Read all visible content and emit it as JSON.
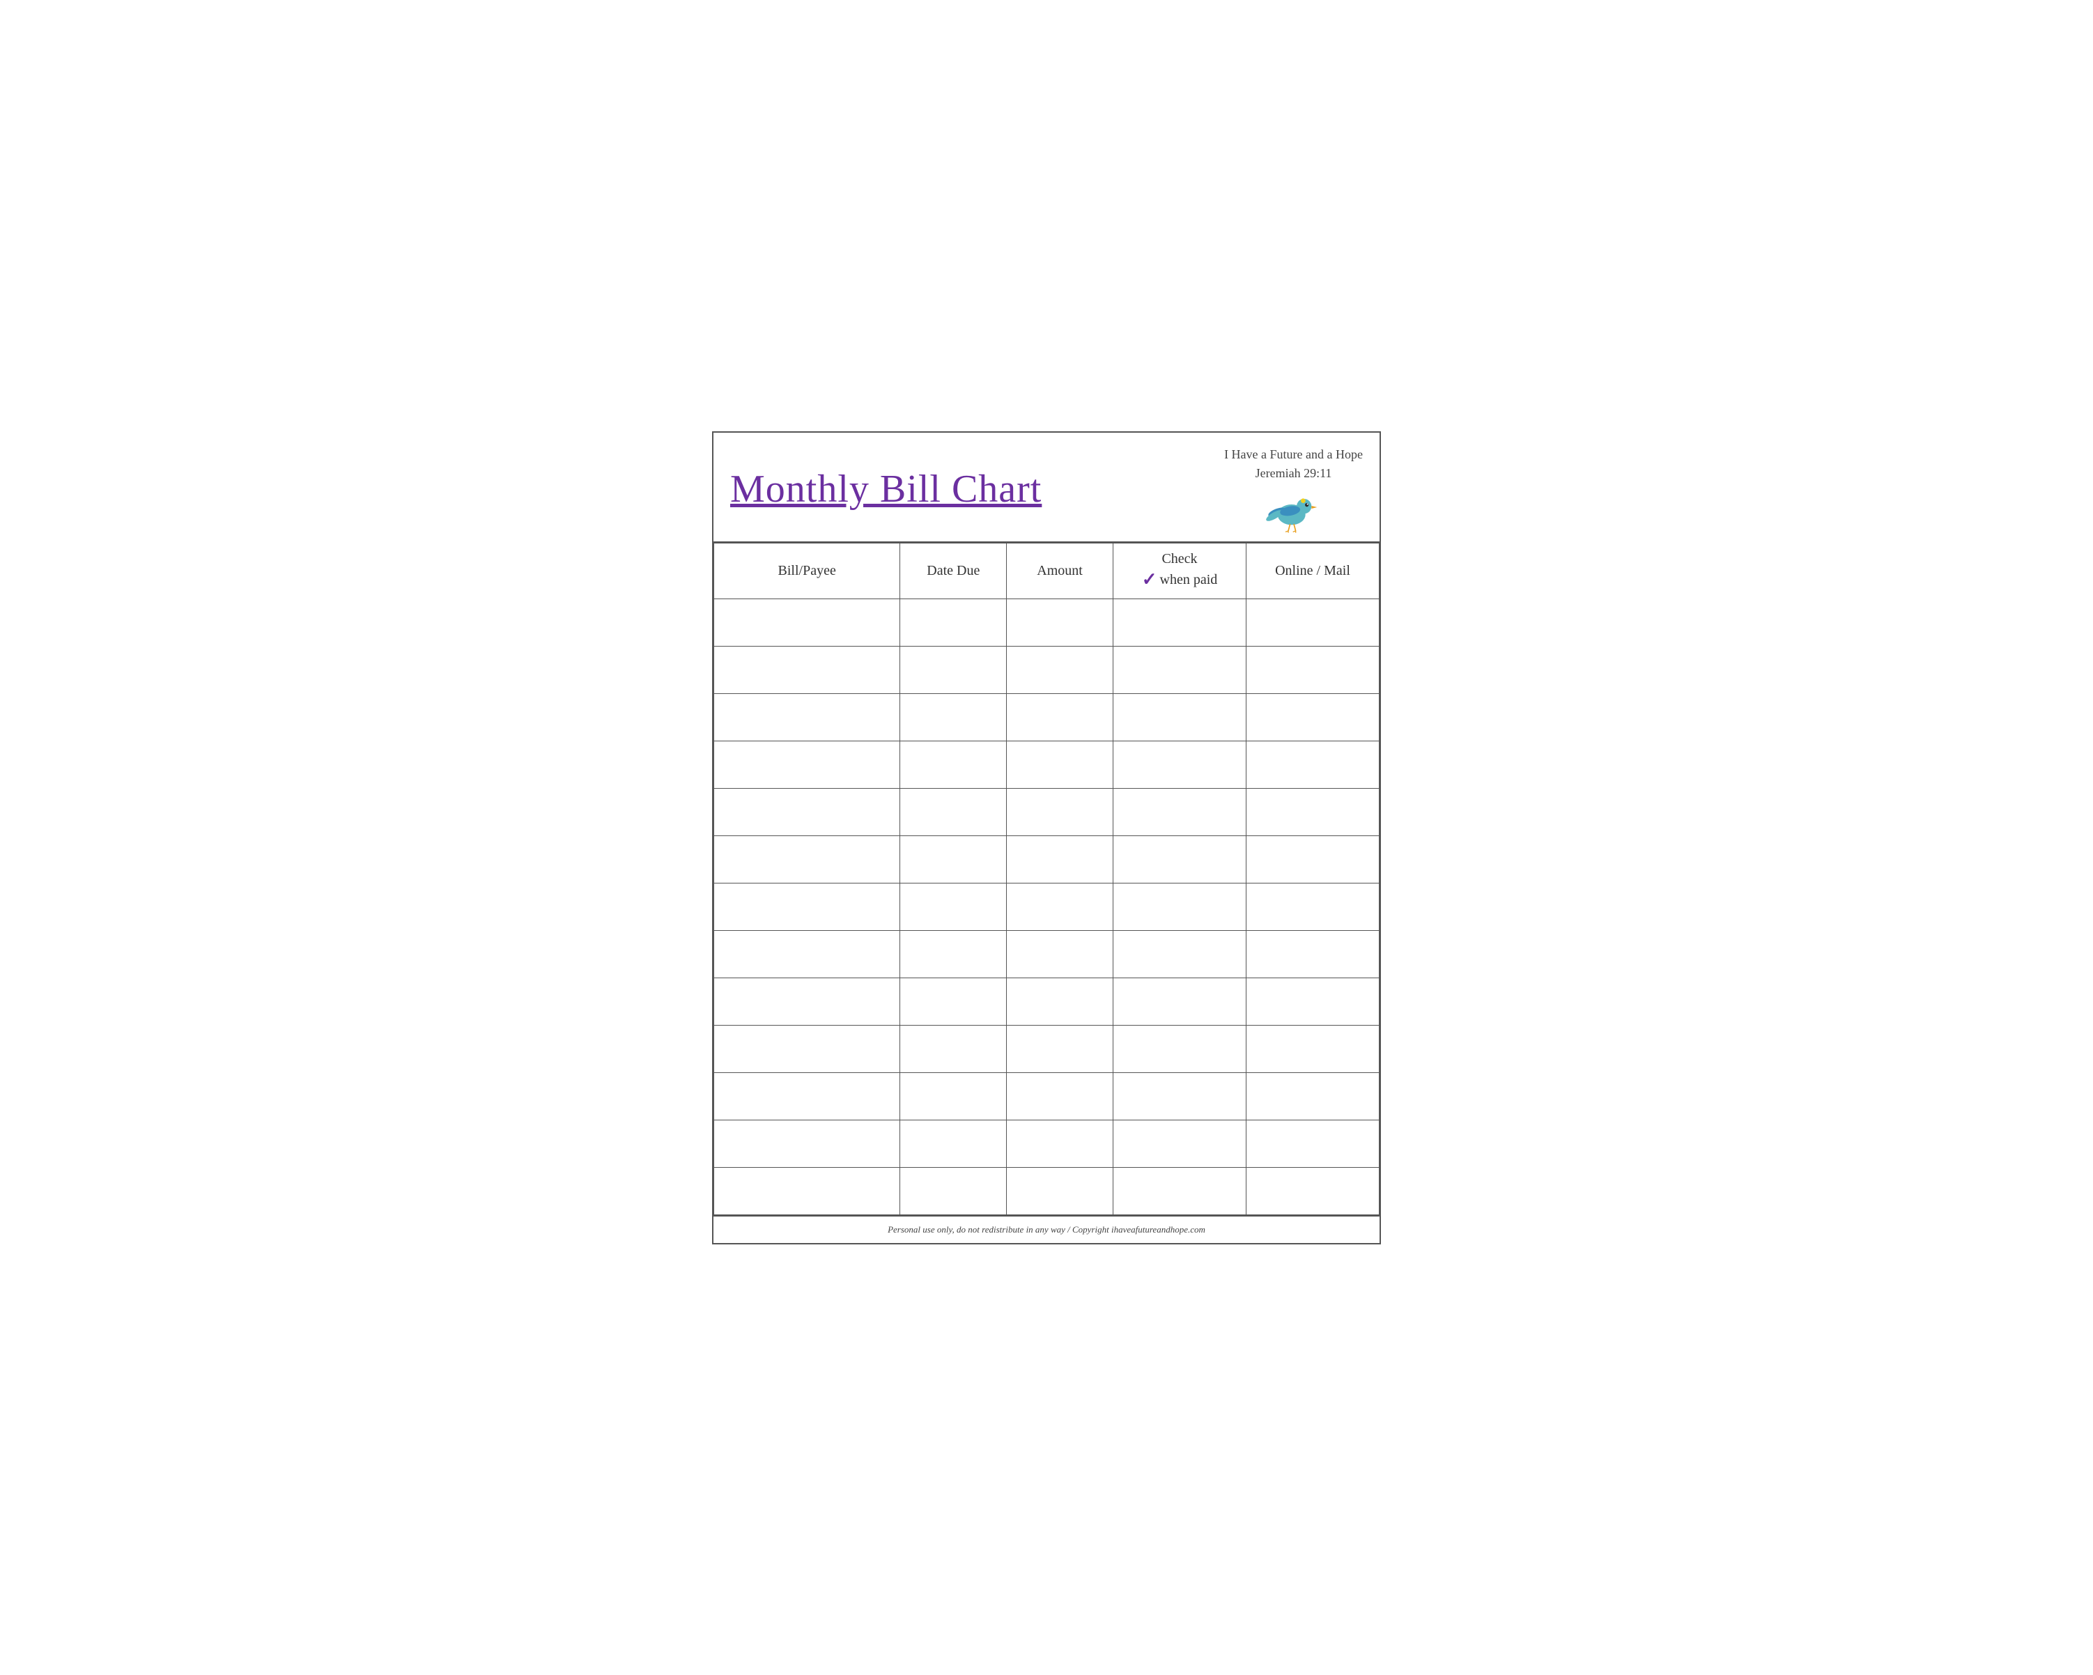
{
  "header": {
    "title": "Monthly Bill Chart",
    "scripture_line1": "I Have a Future and a Hope",
    "scripture_line2": "Jeremiah 29:11"
  },
  "table": {
    "columns": [
      {
        "key": "bill",
        "label": "Bill/Payee"
      },
      {
        "key": "date",
        "label": "Date Due"
      },
      {
        "key": "amount",
        "label": "Amount"
      },
      {
        "key": "check",
        "label_top": "Check",
        "label_bottom": "when paid",
        "has_checkmark": true
      },
      {
        "key": "online",
        "label": "Online / Mail"
      }
    ],
    "row_count": 13
  },
  "footer": {
    "text": "Personal use only, do not redistribute in any way / Copyright ihaveafutureandhope.com"
  }
}
